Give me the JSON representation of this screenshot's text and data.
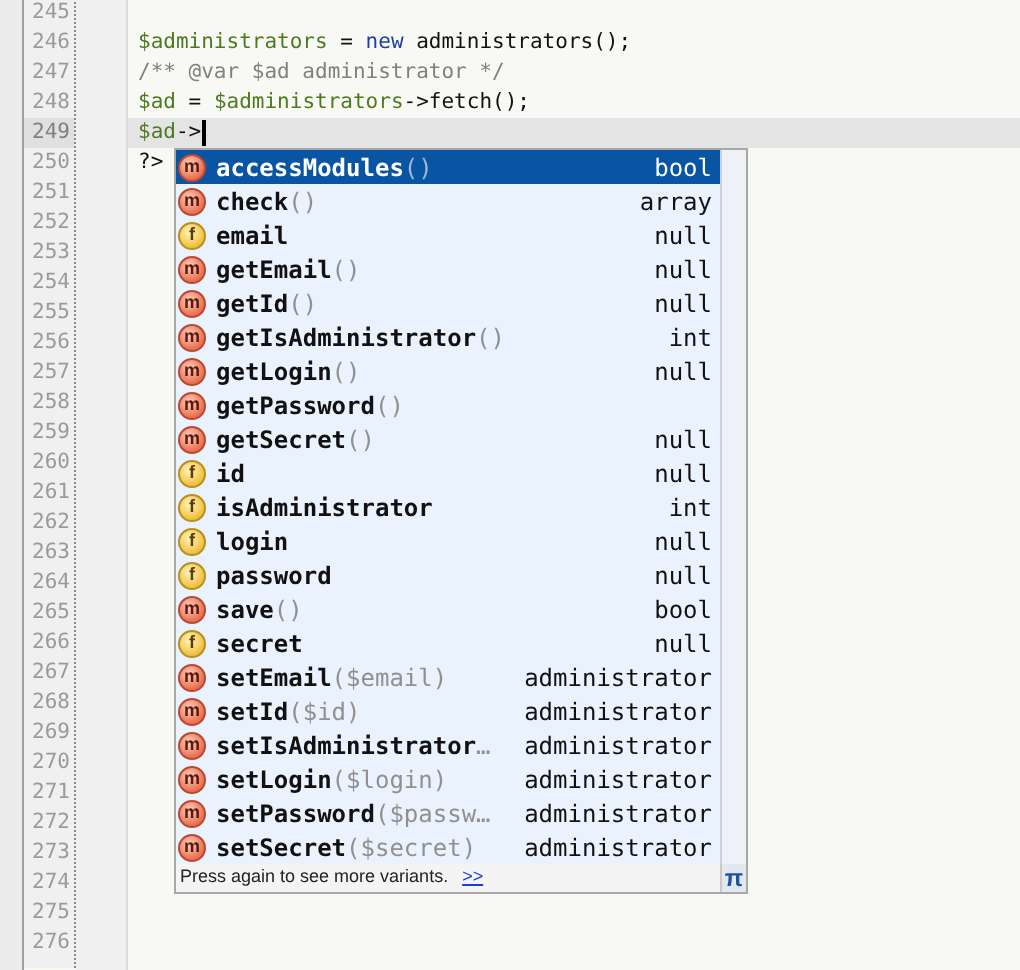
{
  "editor": {
    "lines": [
      {
        "number": "245",
        "current": false
      },
      {
        "number": "246",
        "current": false,
        "tokens": [
          {
            "kind": "variable",
            "text": "$administrators"
          },
          {
            "kind": "plain",
            "text": " = "
          },
          {
            "kind": "keyword",
            "text": "new"
          },
          {
            "kind": "plain",
            "text": " administrators();"
          }
        ]
      },
      {
        "number": "247",
        "current": false,
        "tokens": [
          {
            "kind": "comment",
            "text": "/** @var $ad administrator */"
          }
        ]
      },
      {
        "number": "248",
        "current": false,
        "tokens": [
          {
            "kind": "variable",
            "text": "$ad"
          },
          {
            "kind": "plain",
            "text": " = "
          },
          {
            "kind": "variable",
            "text": "$administrators"
          },
          {
            "kind": "plain",
            "text": "->fetch();"
          }
        ]
      },
      {
        "number": "249",
        "current": true,
        "tokens": [
          {
            "kind": "variable",
            "text": "$ad"
          },
          {
            "kind": "plain",
            "text": "->"
          },
          {
            "kind": "caret"
          }
        ]
      },
      {
        "number": "250",
        "current": false,
        "tokens": [
          {
            "kind": "plain",
            "text": "?>"
          }
        ]
      },
      {
        "number": "251",
        "current": false
      },
      {
        "number": "252",
        "current": false
      },
      {
        "number": "253",
        "current": false
      },
      {
        "number": "254",
        "current": false
      },
      {
        "number": "255",
        "current": false
      },
      {
        "number": "256",
        "current": false
      },
      {
        "number": "257",
        "current": false
      },
      {
        "number": "258",
        "current": false
      },
      {
        "number": "259",
        "current": false
      },
      {
        "number": "260",
        "current": false
      },
      {
        "number": "261",
        "current": false
      },
      {
        "number": "262",
        "current": false
      },
      {
        "number": "263",
        "current": false
      },
      {
        "number": "264",
        "current": false
      },
      {
        "number": "265",
        "current": false
      },
      {
        "number": "266",
        "current": false
      },
      {
        "number": "267",
        "current": false
      },
      {
        "number": "268",
        "current": false
      },
      {
        "number": "269",
        "current": false
      },
      {
        "number": "270",
        "current": false
      },
      {
        "number": "271",
        "current": false
      },
      {
        "number": "272",
        "current": false
      },
      {
        "number": "273",
        "current": false
      },
      {
        "number": "274",
        "current": false
      },
      {
        "number": "275",
        "current": false
      },
      {
        "number": "276",
        "current": false
      }
    ]
  },
  "completion": {
    "items": [
      {
        "kind": "method",
        "badge": "m",
        "name": "accessModules",
        "params": "()",
        "type": "bool",
        "selected": true
      },
      {
        "kind": "method",
        "badge": "m",
        "name": "check",
        "params": "()",
        "type": "array",
        "selected": false
      },
      {
        "kind": "field",
        "badge": "f",
        "name": "email",
        "type": "null",
        "selected": false
      },
      {
        "kind": "method",
        "badge": "m",
        "name": "getEmail",
        "params": "()",
        "type": "null",
        "selected": false
      },
      {
        "kind": "method",
        "badge": "m",
        "name": "getId",
        "params": "()",
        "type": "null",
        "selected": false
      },
      {
        "kind": "method",
        "badge": "m",
        "name": "getIsAdministrator",
        "params": "()",
        "type": "int",
        "selected": false
      },
      {
        "kind": "method",
        "badge": "m",
        "name": "getLogin",
        "params": "()",
        "type": "null",
        "selected": false
      },
      {
        "kind": "method",
        "badge": "m",
        "name": "getPassword",
        "params": "()",
        "selected": false
      },
      {
        "kind": "method",
        "badge": "m",
        "name": "getSecret",
        "params": "()",
        "type": "null",
        "selected": false
      },
      {
        "kind": "field",
        "badge": "f",
        "name": "id",
        "type": "null",
        "selected": false
      },
      {
        "kind": "field",
        "badge": "f",
        "name": "isAdministrator",
        "type": "int",
        "selected": false
      },
      {
        "kind": "field",
        "badge": "f",
        "name": "login",
        "type": "null",
        "selected": false
      },
      {
        "kind": "field",
        "badge": "f",
        "name": "password",
        "type": "null",
        "selected": false
      },
      {
        "kind": "method",
        "badge": "m",
        "name": "save",
        "params": "()",
        "type": "bool",
        "selected": false
      },
      {
        "kind": "field",
        "badge": "f",
        "name": "secret",
        "type": "null",
        "selected": false
      },
      {
        "kind": "method",
        "badge": "m",
        "name": "setEmail",
        "params": "($email)",
        "type": "administrator",
        "selected": false
      },
      {
        "kind": "method",
        "badge": "m",
        "name": "setId",
        "params": "($id)",
        "type": "administrator",
        "selected": false
      },
      {
        "kind": "method",
        "badge": "m",
        "name": "setIsAdministrator",
        "params": "…",
        "type": "administrator",
        "selected": false
      },
      {
        "kind": "method",
        "badge": "m",
        "name": "setLogin",
        "params": "($login)",
        "type": "administrator",
        "selected": false
      },
      {
        "kind": "method",
        "badge": "m",
        "name": "setPassword",
        "params": "($passw…",
        "type": "administrator",
        "selected": false
      },
      {
        "kind": "method",
        "badge": "m",
        "name": "setSecret",
        "params": "($secret)",
        "type": "administrator",
        "selected": false
      }
    ],
    "footer": {
      "text": "Press again to see more variants.",
      "link": ">>"
    },
    "pi_button": "π"
  }
}
